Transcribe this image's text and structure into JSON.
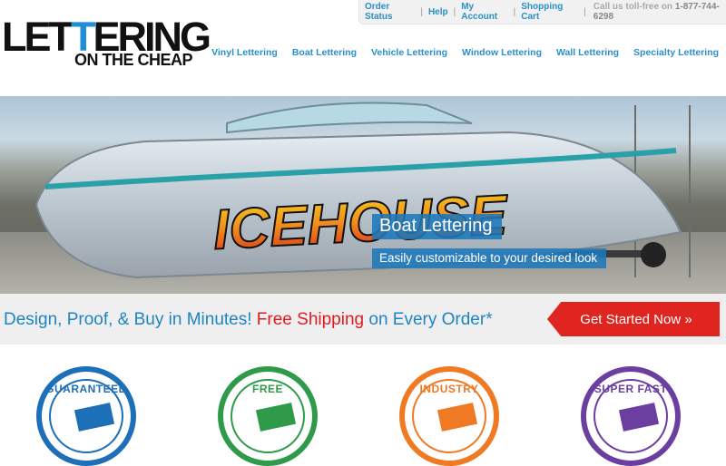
{
  "top_links": [
    "Order Status",
    "Help",
    "My Account",
    "Shopping Cart"
  ],
  "phone": {
    "prefix": "Call us toll-free on",
    "number": "1-877-744-6298"
  },
  "logo": {
    "title": "LETTERING",
    "subtitle": "ON THE CHEAP",
    "lettering_colors": {
      "main": "#111111",
      "accent": "#1e8fd6"
    }
  },
  "nav": [
    "Vinyl Lettering",
    "Boat Lettering",
    "Vehicle Lettering",
    "Window Lettering",
    "Wall Lettering",
    "Specialty Lettering"
  ],
  "hero": {
    "title": "Boat Lettering",
    "subtitle": "Easily customizable to your desired look",
    "boat_text": "ICEHOUSE"
  },
  "promo": {
    "part1": "Design, Proof, & Buy in Minutes!",
    "part2": "Free Shipping",
    "part3": "on Every Order*",
    "cta": "Get Started Now »"
  },
  "badges": [
    {
      "label": "GUARANTEED",
      "color": "#1d6fb8"
    },
    {
      "label": "FREE",
      "color": "#2e9a4a"
    },
    {
      "label": "INDUSTRY",
      "color": "#ef7a23"
    },
    {
      "label": "SUPER FAST",
      "color": "#6b3fa0"
    }
  ],
  "colors": {
    "link": "#2a8fc9",
    "promo_blue": "#1e84c3",
    "promo_red": "#e01b24",
    "cta": "#e0241f"
  }
}
